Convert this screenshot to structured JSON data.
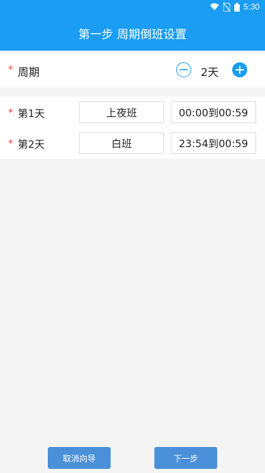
{
  "status": {
    "time": "5:30"
  },
  "header": {
    "title": "第一步 周期倒班设置"
  },
  "period": {
    "required_mark": "*",
    "label": "周期",
    "value": "2天"
  },
  "days": [
    {
      "required_mark": "*",
      "label": "第1天",
      "shift": "上夜班",
      "time_range": "00:00到00:59"
    },
    {
      "required_mark": "*",
      "label": "第2天",
      "shift": "白班",
      "time_range": "23:54到00:59"
    }
  ],
  "footer": {
    "cancel_label": "取消向导",
    "next_label": "下一步"
  },
  "colors": {
    "primary": "#1a9df2",
    "button": "#4a90d9",
    "required": "#e53935"
  }
}
